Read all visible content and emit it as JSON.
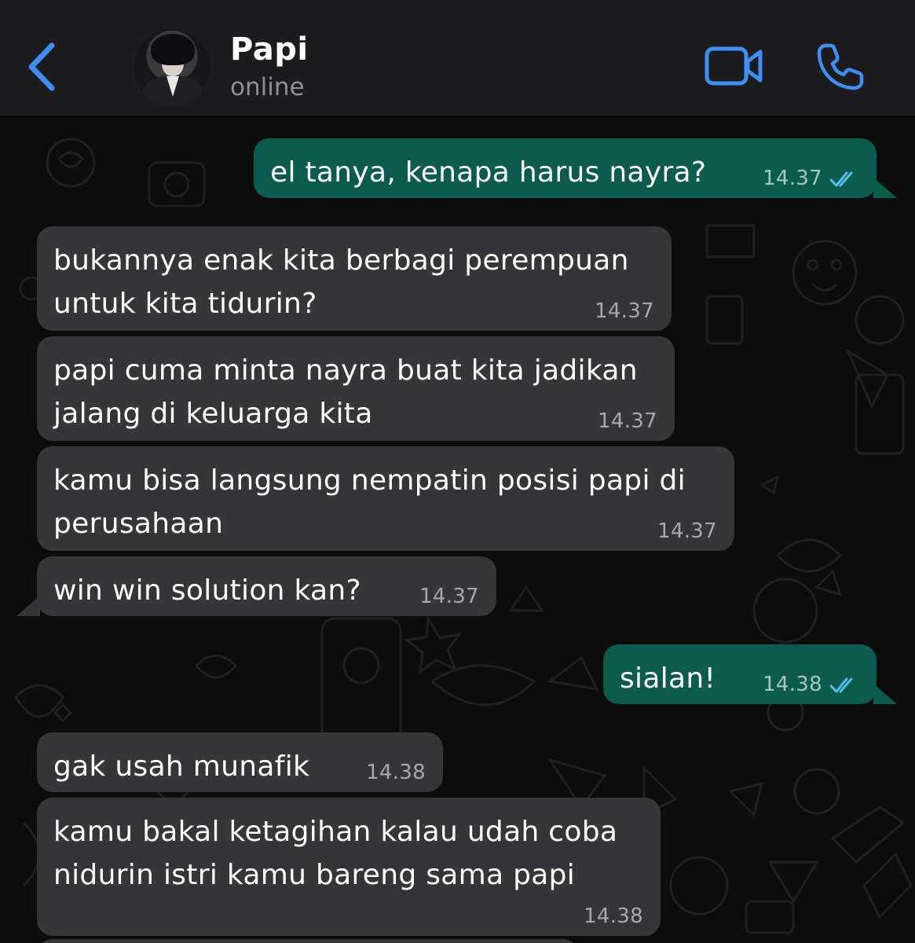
{
  "header": {
    "contact_name": "Papi",
    "contact_status": "online",
    "accent_color": "#3d8ef5"
  },
  "icons": {
    "back": "chevron-left-icon",
    "video": "video-camera-icon",
    "call": "phone-icon",
    "read": "double-check-icon"
  },
  "messages": [
    {
      "direction": "out",
      "text": "el tanya, kenapa harus nayra?",
      "time": "14.37",
      "status": "read"
    },
    {
      "direction": "in",
      "text": "bukannya enak kita berbagi perempuan\nuntuk kita tidurin?",
      "time": "14.37"
    },
    {
      "direction": "in",
      "text": "papi cuma minta nayra buat kita jadikan\njalang di keluarga kita",
      "time": "14.37"
    },
    {
      "direction": "in",
      "text": "kamu bisa langsung nempatin posisi papi di\nperusahaan",
      "time": "14.37"
    },
    {
      "direction": "in",
      "text": "win win solution kan?",
      "time": "14.37"
    },
    {
      "direction": "out",
      "text": "sialan!",
      "time": "14.38",
      "status": "read"
    },
    {
      "direction": "in",
      "text": "gak usah munafik",
      "time": "14.38"
    },
    {
      "direction": "in",
      "text": "kamu bakal ketagihan kalau udah coba\nnidurin istri kamu bareng sama papi",
      "time": "14.38"
    }
  ],
  "colors": {
    "header_bg": "#1c1c1e",
    "outgoing_bubble": "#0b5c4d",
    "incoming_bubble": "#363638",
    "read_ticks": "#53bdeb"
  }
}
